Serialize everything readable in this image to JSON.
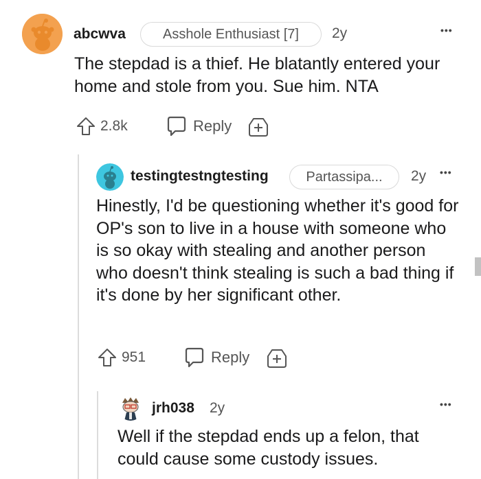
{
  "comments": [
    {
      "username": "abcwva",
      "flair": "Asshole Enthusiast [7]",
      "time": "2y",
      "body": "The stepdad is a thief. He blatantly entered your home and stole from you. Sue him. NTA",
      "upvotes": "2.8k",
      "reply_label": "Reply",
      "menu": "•••",
      "avatar_color": "#f4a460"
    },
    {
      "username": "testingtestngtesting",
      "flair": "Partassipa...",
      "time": "2y",
      "body": "Hinestly, I'd be questioning whether it's good for OP's son to live in a house with someone who is so okay with stealing and another person who doesn't think stealing is such a bad thing if it's done by her significant other.",
      "upvotes": "951",
      "reply_label": "Reply",
      "menu": "•••",
      "avatar_color": "#3ec6e0"
    },
    {
      "username": "jrh038",
      "time": "2y",
      "body": "Well if the stepdad ends up a felon, that could cause some custody issues.",
      "menu": "•••"
    }
  ]
}
